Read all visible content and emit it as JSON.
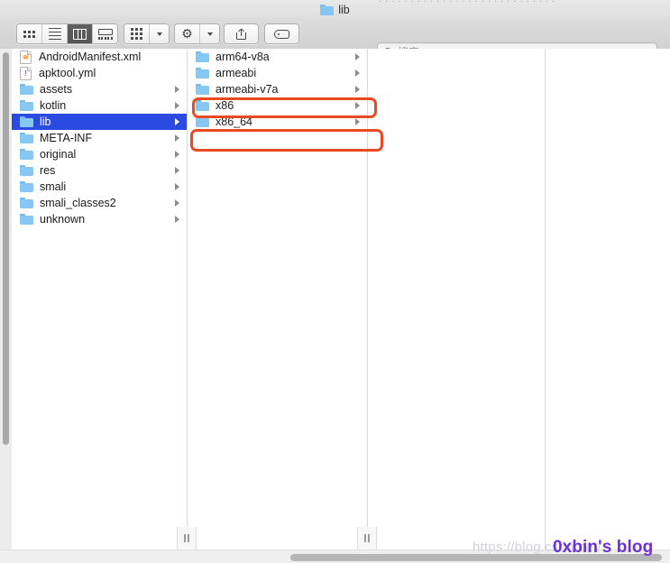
{
  "window": {
    "title": "lib",
    "title_icon": "folder-icon",
    "titlebar_ghost_text": "· · · · · · · · · · · · · · · · · · · · · · · · · · · ·"
  },
  "toolbar": {
    "view_modes": [
      {
        "name": "icon-view",
        "icon": "grid-icon",
        "label": "Icon View",
        "active": false
      },
      {
        "name": "list-view",
        "icon": "list-icon",
        "label": "List View",
        "active": false
      },
      {
        "name": "column-view",
        "icon": "column-icon",
        "label": "Column View",
        "active": true
      },
      {
        "name": "gallery-view",
        "icon": "gallery-icon",
        "label": "Gallery View",
        "active": false
      }
    ],
    "arrange": {
      "icon": "group-icon",
      "chevron": "chevron-down-icon",
      "label": "Arrange By"
    },
    "action": {
      "icon": "gear-icon",
      "chevron": "chevron-down-icon",
      "label": "Action"
    },
    "share": {
      "icon": "share-icon",
      "label": "Share"
    },
    "tag": {
      "icon": "tag-icon",
      "label": "Tags"
    }
  },
  "search": {
    "icon": "search-icon",
    "placeholder": "搜索",
    "value": ""
  },
  "columns": [
    {
      "name": "column-1",
      "rows": [
        {
          "label": "AndroidManifest.xml",
          "kind": "file",
          "glyph": "≋",
          "file_type": "xml",
          "has_disclosure": false,
          "selected": false
        },
        {
          "label": "apktool.yml",
          "kind": "file",
          "glyph": "!",
          "file_type": "yml",
          "has_disclosure": false,
          "selected": false
        },
        {
          "label": "assets",
          "kind": "folder",
          "has_disclosure": true,
          "selected": false
        },
        {
          "label": "kotlin",
          "kind": "folder",
          "has_disclosure": true,
          "selected": false
        },
        {
          "label": "lib",
          "kind": "folder",
          "has_disclosure": true,
          "selected": true
        },
        {
          "label": "META-INF",
          "kind": "folder",
          "has_disclosure": true,
          "selected": false
        },
        {
          "label": "original",
          "kind": "folder",
          "has_disclosure": true,
          "selected": false
        },
        {
          "label": "res",
          "kind": "folder",
          "has_disclosure": true,
          "selected": false
        },
        {
          "label": "smali",
          "kind": "folder",
          "has_disclosure": true,
          "selected": false
        },
        {
          "label": "smali_classes2",
          "kind": "folder",
          "has_disclosure": true,
          "selected": false
        },
        {
          "label": "unknown",
          "kind": "folder",
          "has_disclosure": true,
          "selected": false
        }
      ]
    },
    {
      "name": "column-2",
      "rows": [
        {
          "label": "arm64-v8a",
          "kind": "folder",
          "has_disclosure": true,
          "selected": false
        },
        {
          "label": "armeabi",
          "kind": "folder",
          "has_disclosure": true,
          "selected": false
        },
        {
          "label": "armeabi-v7a",
          "kind": "folder",
          "has_disclosure": true,
          "selected": false
        },
        {
          "label": "x86",
          "kind": "folder",
          "has_disclosure": true,
          "selected": false
        },
        {
          "label": "x86_64",
          "kind": "folder",
          "has_disclosure": true,
          "selected": false
        }
      ]
    },
    {
      "name": "column-3",
      "rows": []
    },
    {
      "name": "column-4",
      "rows": []
    }
  ],
  "annotations": [
    {
      "name": "highlight-arm64-v8a",
      "target": "arm64-v8a",
      "color": "#eb4a20"
    },
    {
      "name": "highlight-armeabi-v7a",
      "target": "armeabi-v7a",
      "color": "#eb4a20"
    }
  ],
  "watermark": {
    "faint_url": "https://blog.csdn.net/",
    "blog_name": "0xbin's blog",
    "blog_color": "#6a30d6"
  },
  "scrollbars": {
    "vertical_present": true,
    "horizontal_present": true
  }
}
